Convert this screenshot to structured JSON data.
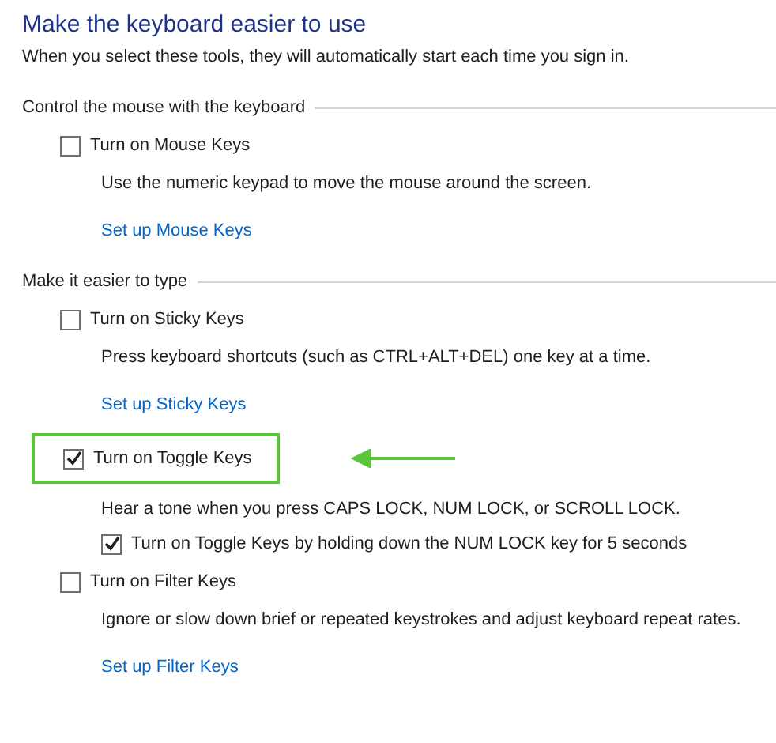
{
  "title": "Make the keyboard easier to use",
  "subtitle": "When you select these tools, they will automatically start each time you sign in.",
  "sections": [
    {
      "heading": "Control the mouse with the keyboard",
      "options": [
        {
          "label": "Turn on Mouse Keys",
          "checked": false,
          "highlighted": false,
          "description": "Use the numeric keypad to move the mouse around the screen.",
          "link": "Set up Mouse Keys"
        }
      ]
    },
    {
      "heading": "Make it easier to type",
      "options": [
        {
          "label": "Turn on Sticky Keys",
          "checked": false,
          "highlighted": false,
          "description": "Press keyboard shortcuts (such as CTRL+ALT+DEL) one key at a time.",
          "link": "Set up Sticky Keys"
        },
        {
          "label": "Turn on Toggle Keys",
          "checked": true,
          "highlighted": true,
          "description": "Hear a tone when you press CAPS LOCK, NUM LOCK, or SCROLL LOCK.",
          "sub_option": {
            "label": "Turn on Toggle Keys by holding down the NUM LOCK key for 5 seconds",
            "checked": true
          }
        },
        {
          "label": "Turn on Filter Keys",
          "checked": false,
          "highlighted": false,
          "description": "Ignore or slow down brief or repeated keystrokes and adjust keyboard repeat rates.",
          "link": "Set up Filter Keys"
        }
      ]
    }
  ]
}
